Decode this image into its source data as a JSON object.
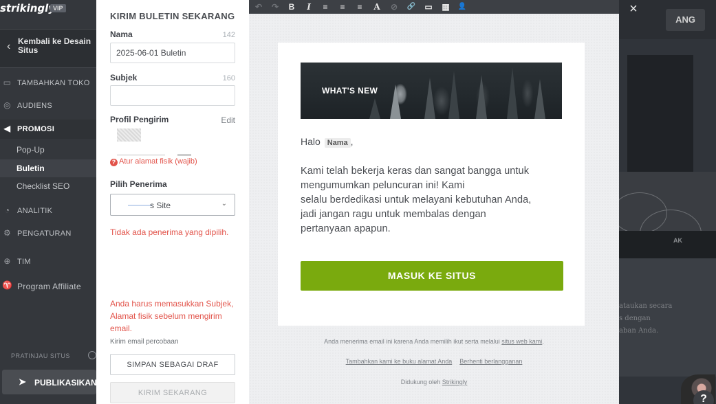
{
  "app": {
    "logo": "strikingly",
    "badge": "VIP"
  },
  "sidebar": {
    "back_label": "Kembali ke Desain Situs",
    "nav": [
      {
        "label": "TAMBAHKAN TOKO",
        "icon": "store-icon"
      },
      {
        "label": "AUDIENS",
        "icon": "users-icon"
      },
      {
        "label": "PROMOSI",
        "icon": "megaphone-icon"
      },
      {
        "label": "ANALITIK",
        "icon": "chart-icon"
      },
      {
        "label": "PENGATURAN",
        "icon": "gear-icon"
      },
      {
        "label": "TIM",
        "icon": "team-icon"
      },
      {
        "label": "Program Affiliate",
        "icon": "trophy-icon"
      }
    ],
    "promo_sub": [
      {
        "label": "Pop-Up"
      },
      {
        "label": "Buletin"
      },
      {
        "label": "Checklist SEO"
      }
    ],
    "preview_label": "PRATINJAU SITUS",
    "publish_label": "PUBLIKASIKAN"
  },
  "form": {
    "title": "KIRIM BULETIN SEKARANG",
    "name_label": "Nama",
    "name_counter": "142",
    "name_value": "2025-06-01 Buletin",
    "subject_label": "Subjek",
    "subject_counter": "160",
    "subject_value": "",
    "sender_label": "Profil Pengirim",
    "sender_edit": "Edit",
    "address_warning": "Atur alamat fisik (wajib)",
    "recipient_label": "Pilih Penerima",
    "recipient_value": "s Site",
    "no_recipient_error": "Tidak ada penerima yang dipilih.",
    "send_error": "Anda harus memasukkan Subjek, Alamat fisik sebelum mengirim email.",
    "test_email_link": "Kirim email percobaan",
    "save_draft_label": "SIMPAN SEBAGAI DRAF",
    "send_now_label": "KIRIM SEKARANG"
  },
  "toolbar": {
    "buttons": [
      {
        "name": "undo-icon",
        "glyph": "↶",
        "enabled": false
      },
      {
        "name": "redo-icon",
        "glyph": "↷",
        "enabled": false
      },
      {
        "name": "bold-icon",
        "glyph": "B",
        "enabled": true
      },
      {
        "name": "italic-icon",
        "glyph": "I",
        "enabled": true
      },
      {
        "name": "align-left-icon",
        "glyph": "≡",
        "enabled": true
      },
      {
        "name": "align-center-icon",
        "glyph": "≡",
        "enabled": true
      },
      {
        "name": "align-right-icon",
        "glyph": "≡",
        "enabled": true
      },
      {
        "name": "font-color-icon",
        "glyph": "A",
        "enabled": true
      },
      {
        "name": "clear-format-icon",
        "glyph": "⊘",
        "enabled": false
      },
      {
        "name": "link-icon",
        "glyph": "🔗",
        "enabled": true
      },
      {
        "name": "button-icon",
        "glyph": "▭",
        "enabled": true
      },
      {
        "name": "image-icon",
        "glyph": "▦",
        "enabled": true
      },
      {
        "name": "person-icon",
        "glyph": "👤",
        "enabled": true
      }
    ]
  },
  "email": {
    "banner_title": "WHAT'S NEW",
    "greeting_prefix": "Halo",
    "name_token": "Nama",
    "greeting_suffix": ",",
    "body_lines": [
      "Kami telah bekerja keras dan sangat bangga untuk",
      "mengumumkan peluncuran ini! Kami",
      "selalu berdedikasi untuk melayani kebutuhan Anda,",
      "jadi jangan ragu untuk membalas dengan",
      "pertanyaan apapun."
    ],
    "cta_label": "MASUK KE SITUS",
    "footer_line1_text": "Anda menerima email ini karena Anda memilih ikut serta melalui ",
    "footer_line1_link": "situs web kami",
    "footer_line1_end": ".",
    "footer_link_a": "Tambahkan kami ke buku alamat Anda",
    "footer_link_b": "Berhenti berlangganan",
    "footer_powered_prefix": "Didukung oleh ",
    "footer_powered_link": "Strikingly"
  },
  "background": {
    "button_label": "ANG",
    "band_label": "AK",
    "text_lines": [
      "ataukan secara",
      "s dengan",
      "aban Anda."
    ]
  },
  "colors": {
    "cta_green": "#7aaa0e",
    "error_red": "#e2534a",
    "sidebar_dark": "#34373c"
  }
}
